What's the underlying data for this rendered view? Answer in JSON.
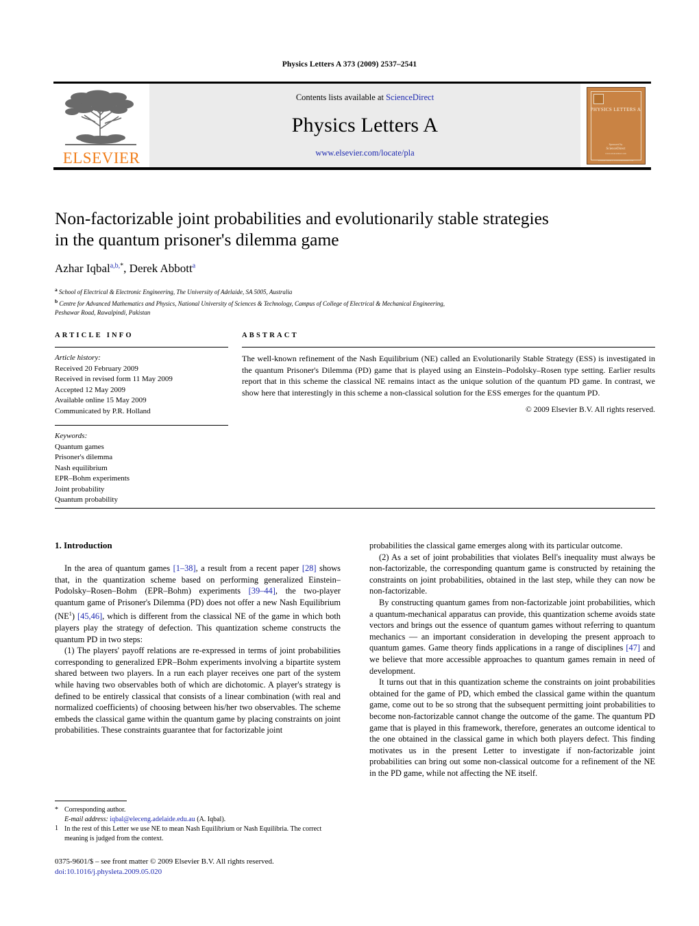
{
  "running_head": "Physics Letters A 373 (2009) 2537–2541",
  "masthead": {
    "contents_prefix": "Contents lists available at ",
    "sciencedirect": "ScienceDirect",
    "journal_name": "Physics Letters A",
    "journal_url": "www.elsevier.com/locate/pla",
    "publisher": "ELSEVIER",
    "cover": {
      "title": "PHYSICS LETTERS A",
      "foot1": "Sponsored by",
      "foot2": "ScienceDirect",
      "foot3": "www.sciencedirect.com",
      "foot4": "available online at www.sciencedirect.com"
    },
    "colors": {
      "elsevier_orange": "#f07d1a",
      "link_blue": "#1c28b0",
      "band_gray": "#ebebeb",
      "cover_orange": "#c98344"
    }
  },
  "title": {
    "line1": "Non-factorizable joint probabilities and evolutionarily stable strategies",
    "line2": "in the quantum prisoner's dilemma game"
  },
  "authors": {
    "author1_name": "Azhar Iqbal",
    "author1_marks": "a,b,",
    "author1_star": "*",
    "separator": ", ",
    "author2_name": "Derek Abbott",
    "author2_marks": "a"
  },
  "affiliations": [
    {
      "mark": "a",
      "text": "School of Electrical & Electronic Engineering, The University of Adelaide, SA 5005, Australia"
    },
    {
      "mark": "b",
      "text": "Centre for Advanced Mathematics and Physics, National University of Sciences & Technology, Campus of College of Electrical & Mechanical Engineering,"
    },
    {
      "mark": "",
      "text": "Peshawar Road, Rawalpindi, Pakistan"
    }
  ],
  "article_info": {
    "heading": "ARTICLE INFO",
    "history_label": "Article history:",
    "history": [
      "Received 20 February 2009",
      "Received in revised form 11 May 2009",
      "Accepted 12 May 2009",
      "Available online 15 May 2009",
      "Communicated by P.R. Holland"
    ],
    "keywords_label": "Keywords:",
    "keywords": [
      "Quantum games",
      "Prisoner's dilemma",
      "Nash equilibrium",
      "EPR–Bohm experiments",
      "Joint probability",
      "Quantum probability"
    ]
  },
  "abstract": {
    "heading": "ABSTRACT",
    "text": "The well-known refinement of the Nash Equilibrium (NE) called an Evolutionarily Stable Strategy (ESS) is investigated in the quantum Prisoner's Dilemma (PD) game that is played using an Einstein–Podolsky–Rosen type setting. Earlier results report that in this scheme the classical NE remains intact as the unique solution of the quantum PD game. In contrast, we show here that interestingly in this scheme a non-classical solution for the ESS emerges for the quantum PD.",
    "copyright": "© 2009 Elsevier B.V. All rights reserved."
  },
  "body": {
    "section_title": "1. Introduction",
    "left_paragraphs": [
      "In the area of quantum games [1–38], a result from a recent paper [28] shows that, in the quantization scheme based on performing generalized Einstein–Podolsky–Rosen–Bohm (EPR–Bohm) experiments [39–44], the two-player quantum game of Prisoner's Dilemma (PD) does not offer a new Nash Equilibrium (NE¹) [45,46], which is different from the classical NE of the game in which both players play the strategy of defection. This quantization scheme constructs the quantum PD in two steps:",
      "(1) The players' payoff relations are re-expressed in terms of joint probabilities corresponding to generalized EPR–Bohm experiments involving a bipartite system shared between two players. In a run each player receives one part of the system while having two observables both of which are dichotomic. A player's strategy is defined to be entirely classical that consists of a linear combination (with real and normalized coefficients) of choosing between his/her two observables. The scheme embeds the classical game within the quantum game by placing constraints on joint probabilities. These constraints guarantee that for factorizable joint"
    ],
    "right_paragraphs": [
      "probabilities the classical game emerges along with its particular outcome.",
      "(2) As a set of joint probabilities that violates Bell's inequality must always be non-factorizable, the corresponding quantum game is constructed by retaining the constraints on joint probabilities, obtained in the last step, while they can now be non-factorizable.",
      "By constructing quantum games from non-factorizable joint probabilities, which a quantum-mechanical apparatus can provide, this quantization scheme avoids state vectors and brings out the essence of quantum games without referring to quantum mechanics — an important consideration in developing the present approach to quantum games. Game theory finds applications in a range of disciplines [47] and we believe that more accessible approaches to quantum games remain in need of development.",
      "It turns out that in this quantization scheme the constraints on joint probabilities obtained for the game of PD, which embed the classical game within the quantum game, come out to be so strong that the subsequent permitting joint probabilities to become non-factorizable cannot change the outcome of the game. The quantum PD game that is played in this framework, therefore, generates an outcome identical to the one obtained in the classical game in which both players defect. This finding motivates us in the present Letter to investigate if non-factorizable joint probabilities can bring out some non-classical outcome for a refinement of the NE in the PD game, while not affecting the NE itself."
    ]
  },
  "footnotes": {
    "corresponding_mark": "*",
    "corresponding_text": "Corresponding author.",
    "email_label": "E-mail address:",
    "email": "iqbal@eleceng.adelaide.edu.au",
    "email_owner": "(A. Iqbal).",
    "note_mark": "1",
    "note_text": "In the rest of this Letter we use NE to mean Nash Equilibrium or Nash Equilibria. The correct meaning is judged from the context."
  },
  "issn_footer": {
    "line1": "0375-9601/$ – see front matter © 2009 Elsevier B.V. All rights reserved.",
    "doi": "doi:10.1016/j.physleta.2009.05.020"
  }
}
